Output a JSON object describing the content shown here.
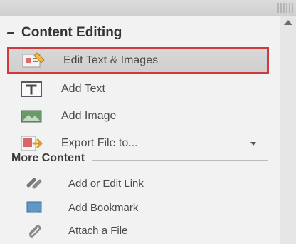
{
  "panel": {
    "section_title": "Content Editing",
    "items": [
      {
        "label": "Edit Text & Images",
        "icon": "edit-text-images-icon",
        "selected": true
      },
      {
        "label": "Add Text",
        "icon": "add-text-icon"
      },
      {
        "label": "Add Image",
        "icon": "add-image-icon"
      },
      {
        "label": "Export File to...",
        "icon": "export-file-icon",
        "has_dropdown": true
      }
    ],
    "more_title": "More Content",
    "more_items": [
      {
        "label": "Add or Edit Link",
        "icon": "link-icon"
      },
      {
        "label": "Add Bookmark",
        "icon": "bookmark-icon"
      },
      {
        "label": "Attach a File",
        "icon": "paperclip-icon"
      }
    ]
  },
  "colors": {
    "selection_outline": "#d13a3a"
  }
}
